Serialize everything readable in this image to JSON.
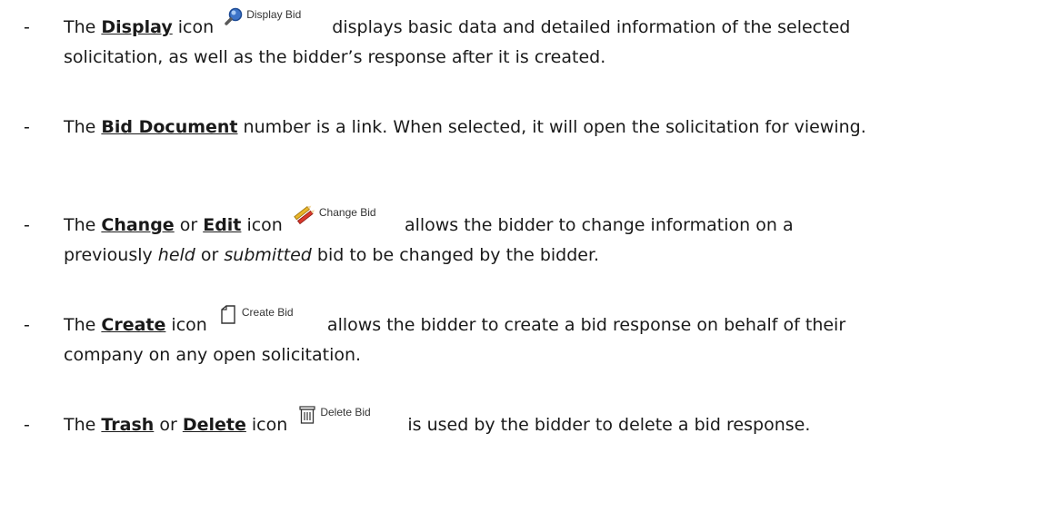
{
  "items": [
    {
      "prefix": "The ",
      "keyword": "Display",
      "middle": " icon",
      "button": {
        "label": "Display Bid",
        "icon": "magnifier-icon"
      },
      "after": "displays basic data and detailed information of the selected",
      "line2": "solicitation, as well as the bidder’s response after it is created."
    },
    {
      "prefix": "The ",
      "keyword": "Bid Document",
      "after": " number is a link. When selected, it will open the solicitation for viewing."
    },
    {
      "prefix": "The ",
      "keyword": "Change",
      "or": " or ",
      "keyword2": "Edit",
      "middle": " icon",
      "button": {
        "label": "Change Bid",
        "icon": "pencils-icon"
      },
      "after": "allows the bidder to change information on a",
      "line2_pre": "previously ",
      "line2_em1": "held",
      "line2_mid": " or ",
      "line2_em2": "submitted",
      "line2_post": " bid to be changed by the bidder."
    },
    {
      "prefix": "The ",
      "keyword": "Create",
      "middle": " icon",
      "button": {
        "label": "Create Bid",
        "icon": "document-icon"
      },
      "after": "allows the bidder to create a bid response on behalf of their",
      "line2": "company on any open solicitation."
    },
    {
      "prefix": "The ",
      "keyword": "Trash",
      "or": " or ",
      "keyword2": "Delete",
      "middle": " icon",
      "button": {
        "label": "Delete Bid",
        "icon": "trash-icon"
      },
      "after": "is used by the bidder to delete a bid response."
    }
  ],
  "dash": "-"
}
